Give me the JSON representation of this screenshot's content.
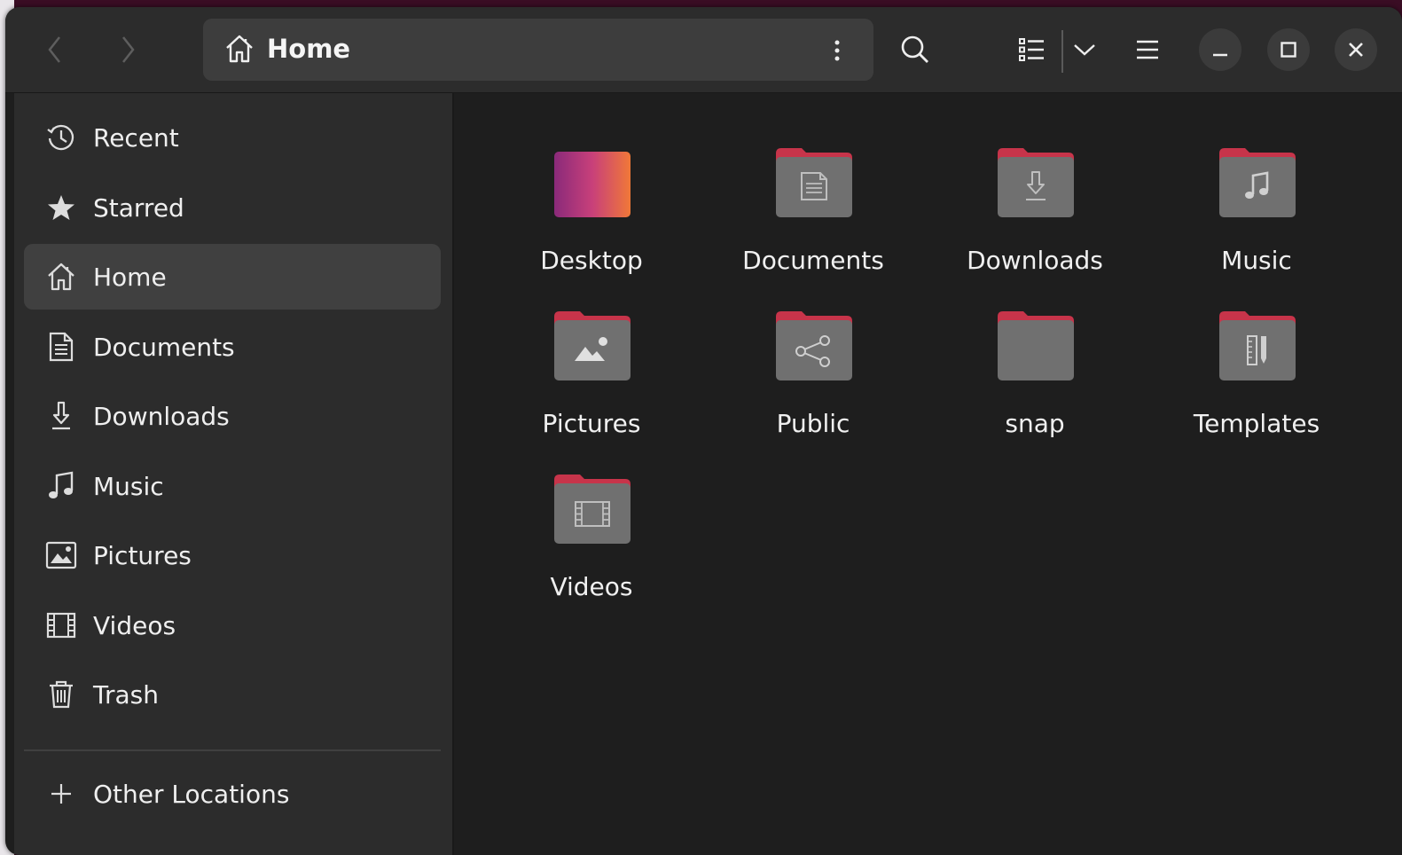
{
  "window": {
    "location_title": "Home",
    "colors": {
      "accent": "#e95420",
      "folder_body": "#6e6e6e",
      "folder_tab": "#c7344a"
    }
  },
  "toolbar": {
    "back_icon": "chevron-left-icon",
    "forward_icon": "chevron-right-icon",
    "menu_icon": "vertical-dots-icon",
    "search_icon": "search-icon",
    "view_icon": "list-view-icon",
    "view_options_icon": "chevron-down-icon",
    "main_menu_icon": "hamburger-icon",
    "minimize_icon": "minimize-icon",
    "maximize_icon": "maximize-icon",
    "close_icon": "close-icon"
  },
  "sidebar": {
    "items": [
      {
        "label": "Recent",
        "icon": "clock-history-icon"
      },
      {
        "label": "Starred",
        "icon": "star-icon"
      },
      {
        "label": "Home",
        "icon": "home-icon",
        "active": true
      },
      {
        "label": "Documents",
        "icon": "document-icon"
      },
      {
        "label": "Downloads",
        "icon": "download-icon"
      },
      {
        "label": "Music",
        "icon": "music-note-icon"
      },
      {
        "label": "Pictures",
        "icon": "picture-icon"
      },
      {
        "label": "Videos",
        "icon": "film-icon"
      },
      {
        "label": "Trash",
        "icon": "trash-icon"
      }
    ],
    "other_locations": {
      "label": "Other Locations",
      "icon": "plus-icon"
    }
  },
  "files": [
    {
      "name": "Desktop",
      "icon": "desktop-folder-icon"
    },
    {
      "name": "Documents",
      "icon": "documents-folder-icon"
    },
    {
      "name": "Downloads",
      "icon": "downloads-folder-icon"
    },
    {
      "name": "Music",
      "icon": "music-folder-icon"
    },
    {
      "name": "Pictures",
      "icon": "pictures-folder-icon"
    },
    {
      "name": "Public",
      "icon": "public-folder-icon"
    },
    {
      "name": "snap",
      "icon": "folder-icon"
    },
    {
      "name": "Templates",
      "icon": "templates-folder-icon"
    },
    {
      "name": "Videos",
      "icon": "videos-folder-icon"
    }
  ]
}
